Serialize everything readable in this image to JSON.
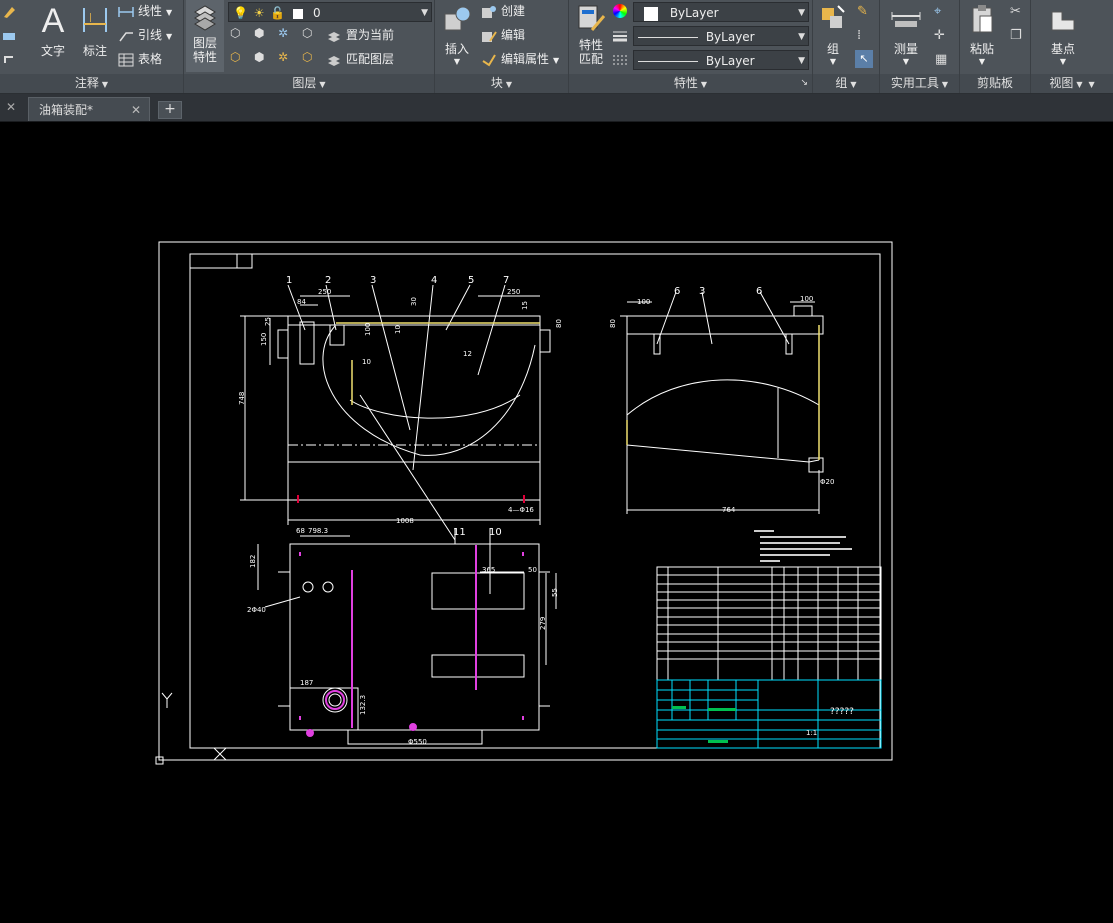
{
  "ribbon": {
    "annotation": {
      "title": "注释",
      "text_label": "文字",
      "dimension_label": "标注",
      "linear_label": "线性",
      "leader_label": "引线",
      "table_label": "表格"
    },
    "layers": {
      "title": "图层",
      "layer_props_label": "图层\n特性",
      "layer_props_line1": "图层",
      "layer_props_line2": "特性",
      "current_layer": "0",
      "set_current_label": "置为当前",
      "match_layer_label": "匹配图层"
    },
    "block": {
      "title": "块",
      "insert_label": "插入",
      "create_label": "创建",
      "edit_label": "编辑",
      "edit_attributes_label": "编辑属性"
    },
    "properties": {
      "title": "特性",
      "match_props_line1": "特性",
      "match_props_line2": "匹配",
      "color_value": "ByLayer",
      "lineweight_value": "ByLayer",
      "linetype_value": "ByLayer"
    },
    "groups": {
      "title": "组",
      "group_label": "组"
    },
    "utilities": {
      "title": "实用工具",
      "measure_label": "测量"
    },
    "clipboard": {
      "title": "剪贴板",
      "paste_label": "粘贴"
    },
    "view": {
      "title": "视图",
      "base_label": "基点"
    }
  },
  "tabs": {
    "active_tab": "油箱装配*"
  },
  "drawing": {
    "balloons_top": [
      "1",
      "2",
      "3",
      "4",
      "5",
      "7"
    ],
    "balloons_right": [
      "6",
      "3",
      "6"
    ],
    "balloons_mid": [
      "11",
      "10"
    ],
    "dims": {
      "d250a": "250",
      "d250b": "250",
      "d84": "84",
      "d30": "30",
      "d15": "15",
      "d80": "80",
      "d100a": "100",
      "d150": "150",
      "d25": "25",
      "d10a": "10",
      "d10b": "10",
      "d12": "12",
      "d748": "748",
      "d1008": "1008",
      "d4phi": "4—Φ16",
      "d100b": "100",
      "d100c": "100",
      "d80b": "80",
      "d20": "Φ20",
      "d764": "764",
      "d68": "68",
      "d7983": "798.3",
      "d182": "182",
      "d2phi": "2Φ40",
      "d365": "365",
      "d50": "50",
      "d55": "55",
      "d279": "279",
      "d187": "187",
      "d1323": "132.3",
      "d550": "Φ550"
    },
    "title_block": {
      "drawing_title": "?????",
      "scale": "1:1"
    }
  }
}
